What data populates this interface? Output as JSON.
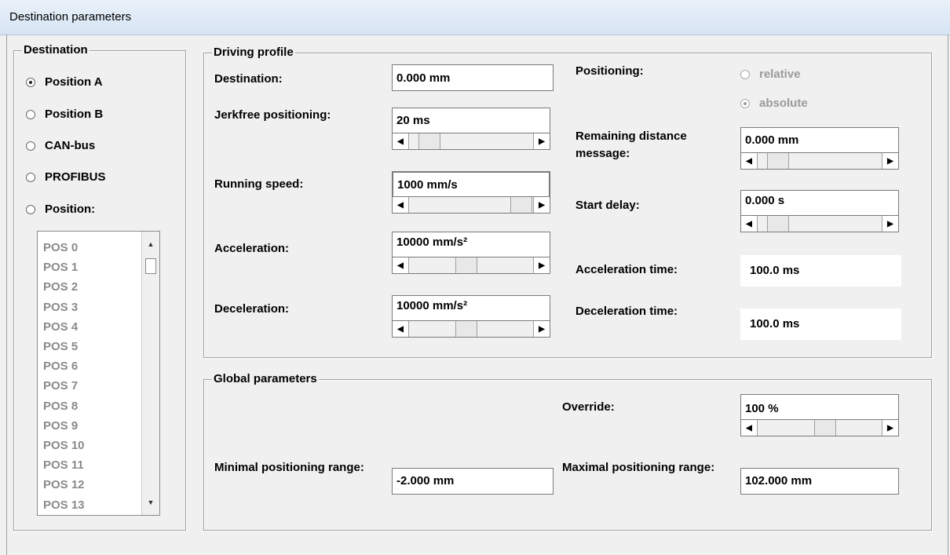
{
  "window": {
    "title": "Destination parameters"
  },
  "destination": {
    "legend": "Destination",
    "options": [
      {
        "label": "Position A",
        "selected": true
      },
      {
        "label": "Position B",
        "selected": false
      },
      {
        "label": "CAN-bus",
        "selected": false
      },
      {
        "label": "PROFIBUS",
        "selected": false
      },
      {
        "label": "Position:",
        "selected": false
      }
    ],
    "positions": [
      "POS 0",
      "POS 1",
      "POS 2",
      "POS 3",
      "POS 4",
      "POS 5",
      "POS 6",
      "POS 7",
      "POS 8",
      "POS 9",
      "POS 10",
      "POS 11",
      "POS 12",
      "POS 13"
    ]
  },
  "driving_profile": {
    "legend": "Driving profile",
    "destination_label": "Destination:",
    "destination_value": "0.000 mm",
    "jerkfree_label": "Jerkfree positioning:",
    "jerkfree_value": "20 ms",
    "running_speed_label": "Running speed:",
    "running_speed_value": "1000 mm/s",
    "acceleration_label": "Acceleration:",
    "acceleration_value": "10000 mm/s²",
    "deceleration_label": "Deceleration:",
    "deceleration_value": "10000 mm/s²",
    "positioning_label": "Positioning:",
    "positioning_options": [
      {
        "label": "relative",
        "selected": false,
        "enabled": false
      },
      {
        "label": "absolute",
        "selected": true,
        "enabled": false
      }
    ],
    "remaining_label": "Remaining distance message:",
    "remaining_value": "0.000 mm",
    "start_delay_label": "Start delay:",
    "start_delay_value": "0.000 s",
    "acc_time_label": "Acceleration time:",
    "acc_time_value": "100.0 ms",
    "dec_time_label": "Deceleration time:",
    "dec_time_value": "100.0 ms"
  },
  "global": {
    "legend": "Global parameters",
    "override_label": "Override:",
    "override_value": "100 %",
    "min_range_label": "Minimal positioning range:",
    "min_range_value": "-2.000 mm",
    "max_range_label": "Maximal positioning range:",
    "max_range_value": "102.000 mm"
  },
  "icons": {
    "scroll_left": "arrow-left-icon",
    "scroll_right": "arrow-right-icon",
    "scroll_up": "arrow-up-icon",
    "scroll_down": "arrow-down-icon"
  }
}
